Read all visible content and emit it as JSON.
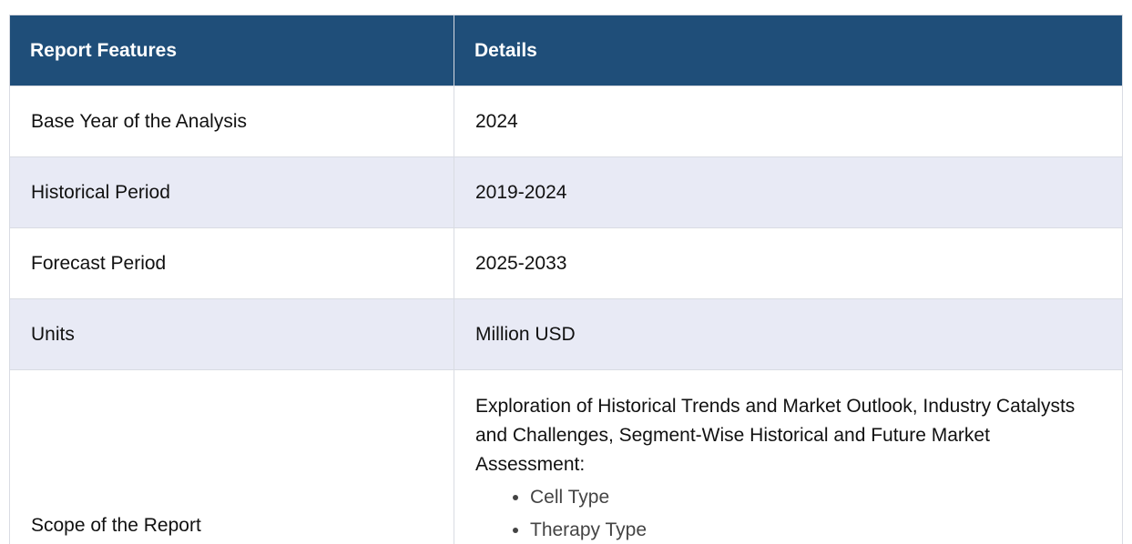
{
  "table": {
    "header": {
      "feature": "Report Features",
      "details": "Details"
    },
    "rows": [
      {
        "feature": "Base Year of the Analysis",
        "detail": "2024"
      },
      {
        "feature": "Historical Period",
        "detail": "2019-2024"
      },
      {
        "feature": "Forecast Period",
        "detail": "2025-2033"
      },
      {
        "feature": "Units",
        "detail": "Million USD"
      }
    ],
    "scope": {
      "feature": "Scope of the Report",
      "intro": "Exploration of Historical Trends and Market Outlook, Industry Catalysts and Challenges, Segment-Wise Historical and Future Market Assessment:",
      "items": [
        "Cell Type",
        "Therapy Type"
      ]
    }
  },
  "colors": {
    "header_bg": "#1f4e79",
    "alt_row_bg": "#e8eaf5",
    "heading_text": "#1f6fb5"
  }
}
